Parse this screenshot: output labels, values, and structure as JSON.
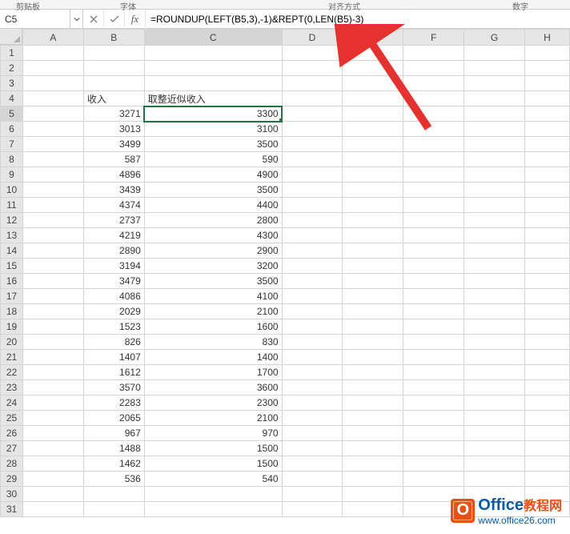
{
  "ribbon": {
    "label1": "剪贴板",
    "label2": "字体",
    "label3": "对齐方式",
    "label4": "数字"
  },
  "namebox": {
    "value": "C5"
  },
  "formula": {
    "value": "=ROUNDUP(LEFT(B5,3),-1)&REPT(0,LEN(B5)-3)"
  },
  "columns": [
    "A",
    "B",
    "C",
    "D",
    "E",
    "F",
    "G",
    "H"
  ],
  "headers": {
    "B4": "收入",
    "C4": "取整近似收入"
  },
  "rows": [
    {
      "n": 1
    },
    {
      "n": 2
    },
    {
      "n": 3
    },
    {
      "n": 4
    },
    {
      "n": 5,
      "b": "3271",
      "c": "3300"
    },
    {
      "n": 6,
      "b": "3013",
      "c": "3100"
    },
    {
      "n": 7,
      "b": "3499",
      "c": "3500"
    },
    {
      "n": 8,
      "b": "587",
      "c": "590"
    },
    {
      "n": 9,
      "b": "4896",
      "c": "4900"
    },
    {
      "n": 10,
      "b": "3439",
      "c": "3500"
    },
    {
      "n": 11,
      "b": "4374",
      "c": "4400"
    },
    {
      "n": 12,
      "b": "2737",
      "c": "2800"
    },
    {
      "n": 13,
      "b": "4219",
      "c": "4300"
    },
    {
      "n": 14,
      "b": "2890",
      "c": "2900"
    },
    {
      "n": 15,
      "b": "3194",
      "c": "3200"
    },
    {
      "n": 16,
      "b": "3479",
      "c": "3500"
    },
    {
      "n": 17,
      "b": "4086",
      "c": "4100"
    },
    {
      "n": 18,
      "b": "2029",
      "c": "2100"
    },
    {
      "n": 19,
      "b": "1523",
      "c": "1600"
    },
    {
      "n": 20,
      "b": "826",
      "c": "830"
    },
    {
      "n": 21,
      "b": "1407",
      "c": "1400"
    },
    {
      "n": 22,
      "b": "1612",
      "c": "1700"
    },
    {
      "n": 23,
      "b": "3570",
      "c": "3600"
    },
    {
      "n": 24,
      "b": "2283",
      "c": "2300"
    },
    {
      "n": 25,
      "b": "2065",
      "c": "2100"
    },
    {
      "n": 26,
      "b": "967",
      "c": "970"
    },
    {
      "n": 27,
      "b": "1488",
      "c": "1500"
    },
    {
      "n": 28,
      "b": "1462",
      "c": "1500"
    },
    {
      "n": 29,
      "b": "536",
      "c": "540"
    },
    {
      "n": 30
    },
    {
      "n": 31
    }
  ],
  "watermark": {
    "brand1": "Office",
    "brand2": "教程网",
    "url": "www.office26.com",
    "logo": "O"
  }
}
